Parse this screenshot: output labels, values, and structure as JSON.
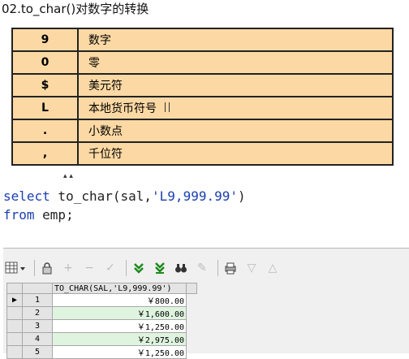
{
  "title": "02.to_char()对数字的转换",
  "format_table": [
    {
      "symbol": "9",
      "meaning": "数字"
    },
    {
      "symbol": "0",
      "meaning": "零"
    },
    {
      "symbol": "$",
      "meaning": "美元符"
    },
    {
      "symbol": "L",
      "meaning": "本地货币符号"
    },
    {
      "symbol": ".",
      "meaning": "小数点"
    },
    {
      "symbol": ",",
      "meaning": "千位符"
    }
  ],
  "sql": {
    "kw_select": "select",
    "func_part": " to_char(sal,",
    "string_part": "'L9,999.99'",
    "close": ")",
    "kw_from": "from",
    "from_rest": " emp;"
  },
  "grid": {
    "column_header": "TO_CHAR(SAL,'L9,999.99')",
    "rows": [
      {
        "num": "1",
        "value": "￥800.00"
      },
      {
        "num": "2",
        "value": "￥1,600.00"
      },
      {
        "num": "3",
        "value": "￥1,250.00"
      },
      {
        "num": "4",
        "value": "￥2,975.00"
      },
      {
        "num": "5",
        "value": "￥1,250.00"
      }
    ]
  },
  "toolbar_icons": [
    "grid-icon",
    "lock-icon",
    "add-icon",
    "remove-icon",
    "check-icon",
    "arrow-down-icon",
    "arrow-down-last-icon",
    "binoculars-icon",
    "eraser-icon",
    "print-icon",
    "triangle-down-icon",
    "triangle-up-icon"
  ]
}
